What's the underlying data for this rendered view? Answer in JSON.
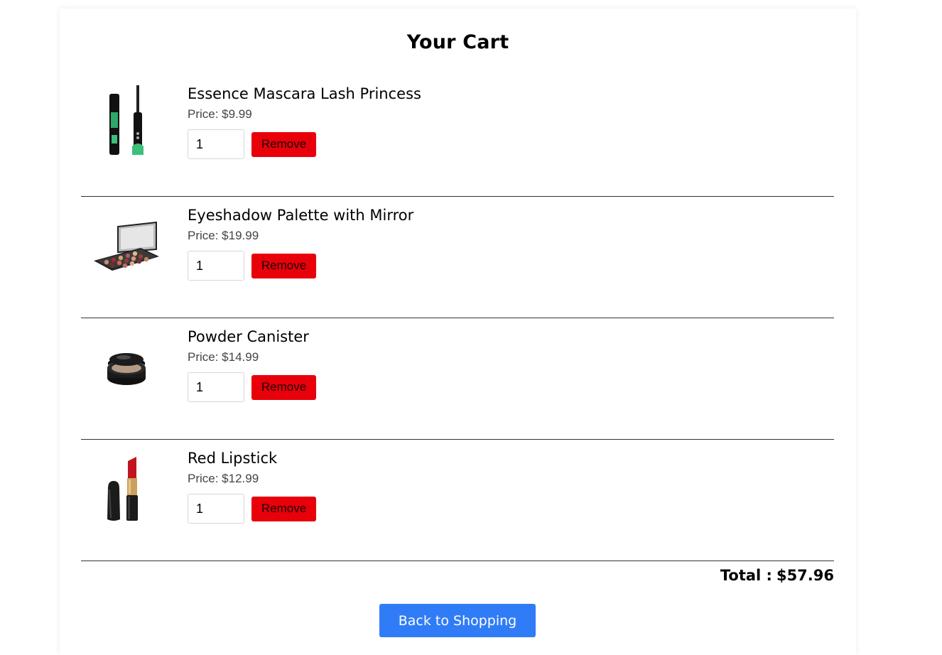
{
  "cart": {
    "title": "Your Cart",
    "items": [
      {
        "name": "Essence Mascara Lash Princess",
        "price_label": "Price: $9.99",
        "quantity": "1",
        "remove_label": "Remove",
        "image_icon": "mascara-icon"
      },
      {
        "name": "Eyeshadow Palette with Mirror",
        "price_label": "Price: $19.99",
        "quantity": "1",
        "remove_label": "Remove",
        "image_icon": "eyeshadow-palette-icon"
      },
      {
        "name": "Powder Canister",
        "price_label": "Price: $14.99",
        "quantity": "1",
        "remove_label": "Remove",
        "image_icon": "powder-canister-icon"
      },
      {
        "name": "Red Lipstick",
        "price_label": "Price: $12.99",
        "quantity": "1",
        "remove_label": "Remove",
        "image_icon": "lipstick-icon"
      }
    ],
    "total_label": "Total :",
    "total_value": "$57.96",
    "back_button_label": "Back to Shopping"
  },
  "colors": {
    "remove_button": "#e8000b",
    "primary_button": "#2f7cf6",
    "divider": "#333333"
  }
}
